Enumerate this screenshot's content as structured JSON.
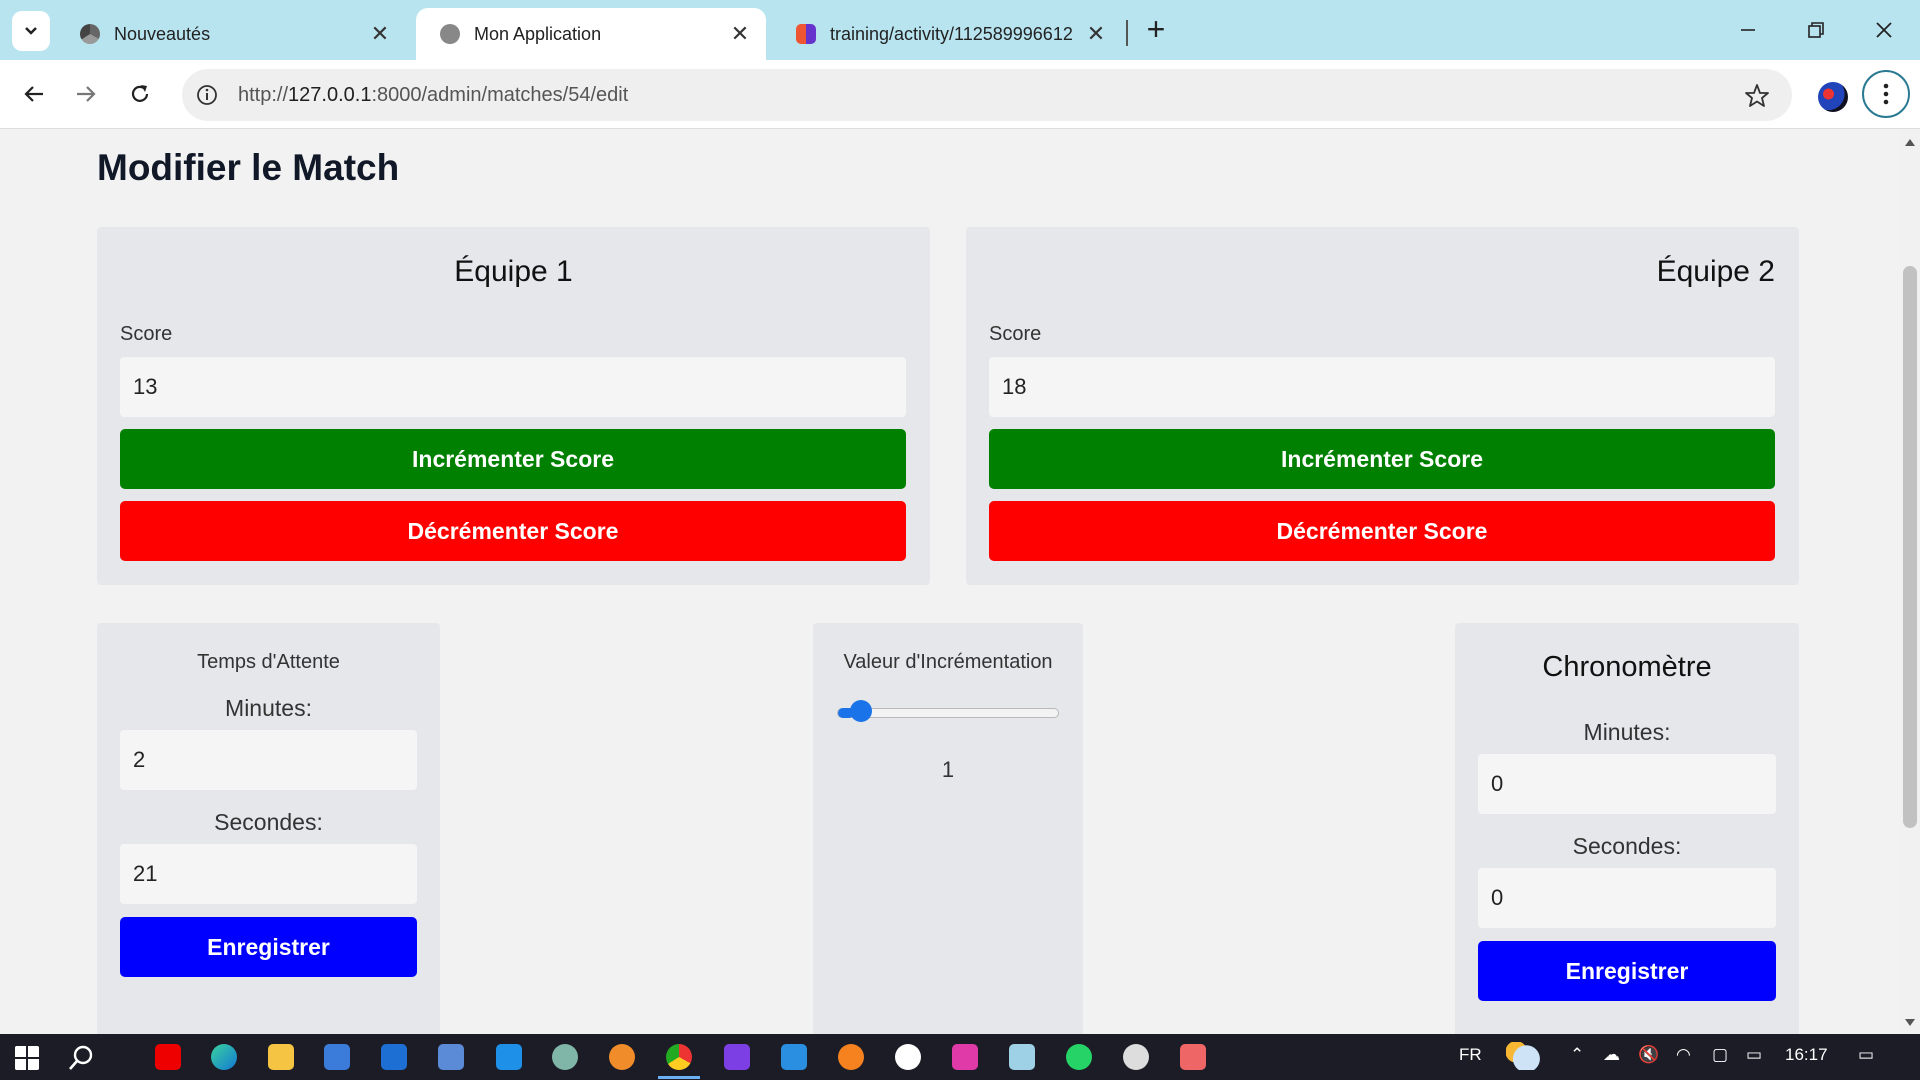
{
  "browser": {
    "tabs": [
      {
        "title": "Nouveautés",
        "icon": "chrome-icon"
      },
      {
        "title": "Mon Application",
        "icon": "globe-icon",
        "active": true
      },
      {
        "title": "training/activity/112589996612",
        "icon": "meet-icon"
      }
    ],
    "url_scheme": "http://",
    "url_host": "127.0.0.1",
    "url_rest": ":8000/admin/matches/54/edit"
  },
  "page": {
    "title": "Modifier le Match",
    "team1": {
      "name": "Équipe 1",
      "score_label": "Score",
      "score": "13",
      "increment_label": "Incrémenter Score",
      "decrement_label": "Décrémenter Score"
    },
    "team2": {
      "name": "Équipe 2",
      "score_label": "Score",
      "score": "18",
      "increment_label": "Incrémenter Score",
      "decrement_label": "Décrémenter Score"
    },
    "wait_time": {
      "title": "Temps d'Attente",
      "minutes_label": "Minutes:",
      "minutes": "2",
      "seconds_label": "Secondes:",
      "seconds": "21",
      "save_label": "Enregistrer"
    },
    "increment": {
      "title": "Valeur d'Incrémentation",
      "value": "1",
      "slider_fraction": 0.07
    },
    "chrono": {
      "title": "Chronomètre",
      "minutes_label": "Minutes:",
      "minutes": "0",
      "seconds_label": "Secondes:",
      "seconds": "0",
      "save_label": "Enregistrer"
    }
  },
  "colors": {
    "increment": "#008000",
    "decrement": "#ff0000",
    "save": "#0000ff",
    "card": "#e5e7eb"
  },
  "taskbar": {
    "language": "FR",
    "time": "16:17"
  }
}
